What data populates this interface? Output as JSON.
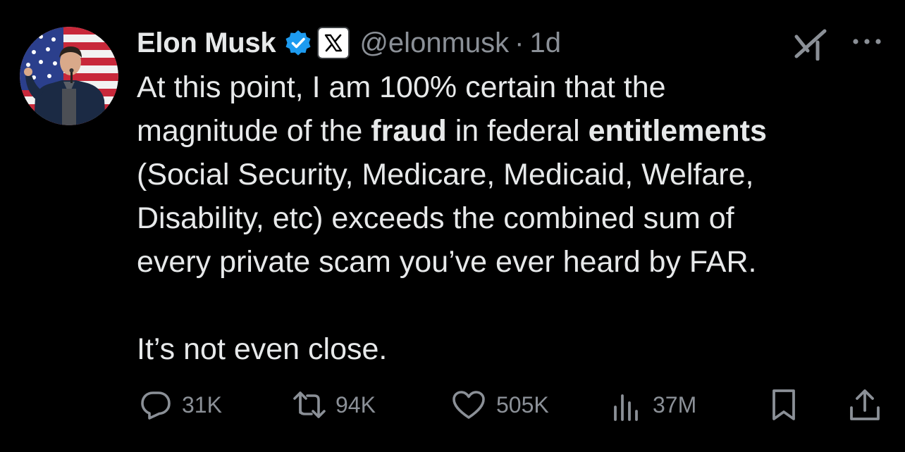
{
  "tweet": {
    "author": {
      "display_name": "Elon Musk",
      "handle": "@elonmusk",
      "verified_badge": "verified-check-icon",
      "affiliate_badge": "x-logo-icon"
    },
    "separator": "·",
    "timestamp": "1d",
    "text": {
      "line1": "At this point, I am 100% certain that the",
      "line2_a": "magnitude of the ",
      "line2_b": "fraud",
      "line2_c": " in federal ",
      "line2_d": "entitlements",
      "line3": "(Social Security, Medicare, Medicaid, Welfare,",
      "line4": "Disability, etc) exceeds the combined sum of",
      "line5": "every private scam you’ve ever heard by FAR.",
      "line6": "It’s not even close."
    },
    "actions": {
      "replies": "31K",
      "reposts": "94K",
      "likes": "505K",
      "views": "37M"
    }
  },
  "icons": {
    "reply": "reply-icon",
    "repost": "repost-icon",
    "like": "heart-icon",
    "views": "views-icon",
    "bookmark": "bookmark-icon",
    "share": "share-icon",
    "grok": "grok-icon",
    "more": "more-icon"
  },
  "colors": {
    "background": "#000000",
    "text": "#e7e9ea",
    "secondary": "#8b9097",
    "verified": "#1d9bf0"
  }
}
